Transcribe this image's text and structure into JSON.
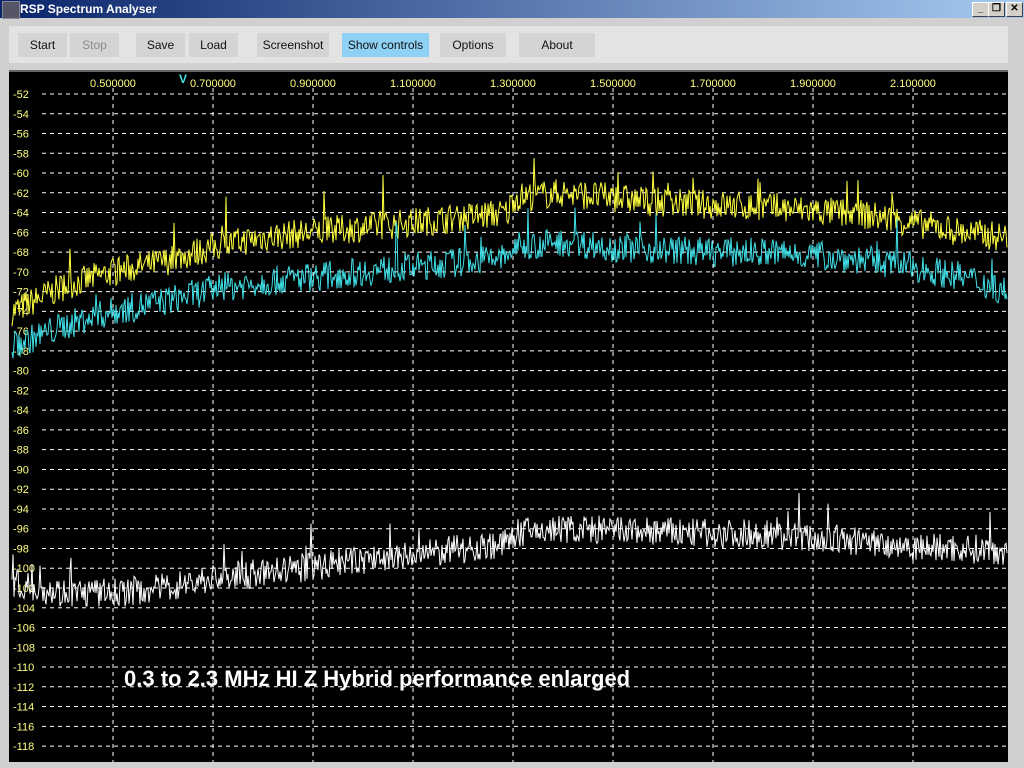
{
  "window": {
    "title": "RSP Spectrum Analyser",
    "controls": [
      "_",
      "❐",
      "✕"
    ]
  },
  "toolbar": {
    "buttons": [
      {
        "label": "Start",
        "state": "enabled"
      },
      {
        "label": "Stop",
        "state": "disabled"
      },
      {
        "label": "Save",
        "state": "enabled"
      },
      {
        "label": "Load",
        "state": "enabled"
      },
      {
        "label": "Screenshot",
        "state": "enabled"
      },
      {
        "label": "Show controls",
        "state": "active"
      },
      {
        "label": "Options",
        "state": "enabled"
      },
      {
        "label": "About",
        "state": "enabled"
      }
    ]
  },
  "annotation": "0.3 to 2.3 MHz HI Z Hybrid performance enlarged",
  "chart_data": {
    "type": "line",
    "xlim": [
      0.298,
      2.288
    ],
    "ylim": [
      -119,
      -51
    ],
    "x_ticks": [
      "0.500000",
      "0.700000",
      "0.900000",
      "1.100000",
      "1.300000",
      "1.500000",
      "1.700000",
      "1.900000",
      "2.100000"
    ],
    "y_ticks": [
      "-52",
      "-54",
      "-56",
      "-58",
      "-60",
      "-62",
      "-64",
      "-66",
      "-68",
      "-70",
      "-72",
      "-74",
      "-76",
      "-78",
      "-80",
      "-82",
      "-84",
      "-86",
      "-88",
      "-90",
      "-92",
      "-94",
      "-96",
      "-98",
      "-100",
      "-102",
      "-104",
      "-106",
      "-108",
      "-110",
      "-112",
      "-114",
      "-116",
      "-118"
    ],
    "grid": true,
    "marker_mhz": 0.64,
    "colors": {
      "background": "#000000",
      "tick_labels": "#ffff80",
      "grid": "#ffffff",
      "marker": "#40e0e0"
    },
    "x": [
      0.3,
      0.4,
      0.5,
      0.6,
      0.7,
      0.8,
      0.9,
      1.0,
      1.1,
      1.2,
      1.29,
      1.3,
      1.4,
      1.5,
      1.6,
      1.7,
      1.8,
      1.9,
      2.0,
      2.1,
      2.2,
      2.29
    ],
    "series": [
      {
        "color": "#ffff40",
        "values": [
          -74,
          -71.5,
          -70,
          -69,
          -67.5,
          -66.5,
          -66,
          -65.5,
          -65,
          -64.5,
          -64,
          -62.5,
          -62,
          -62.5,
          -63,
          -63.2,
          -63.5,
          -63.8,
          -64.2,
          -65,
          -66,
          -66.5
        ]
      },
      {
        "color": "#40e0e8",
        "values": [
          -77.5,
          -75.5,
          -74,
          -73,
          -71.8,
          -71,
          -70.5,
          -70,
          -69.5,
          -69,
          -68.5,
          -67.5,
          -67,
          -67.5,
          -67.8,
          -68,
          -68,
          -68.3,
          -68.8,
          -69.5,
          -70.5,
          -72
        ]
      },
      {
        "color": "#ffffff",
        "values": [
          -101.5,
          -102.5,
          -102.5,
          -102,
          -101,
          -100.5,
          -99.8,
          -99.2,
          -98.8,
          -98,
          -97.5,
          -96.5,
          -96,
          -96.2,
          -96.3,
          -96.5,
          -96.5,
          -97,
          -97.3,
          -97.8,
          -98,
          -98.2
        ]
      }
    ]
  }
}
